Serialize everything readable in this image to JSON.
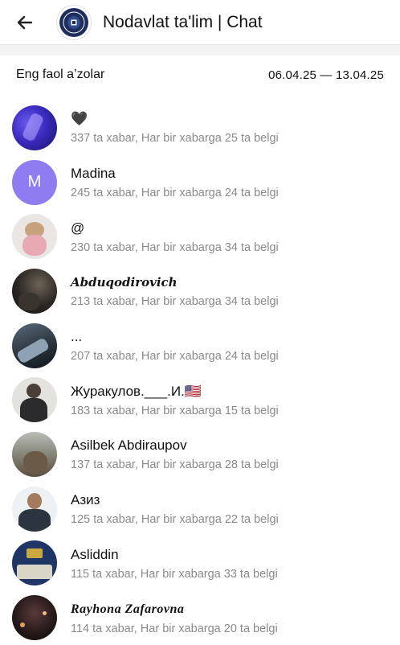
{
  "header": {
    "title": "Nodavlat ta'lim | Chat",
    "back_icon": "arrow-left-icon",
    "logo_icon": "group-logo-icon"
  },
  "section": {
    "title": "Eng faol a’zolar",
    "range": "06.04.25 — 13.04.25"
  },
  "members": [
    {
      "name": "🖤",
      "sub": "337 ta xabar, Har bir xabarga 25 ta belgi"
    },
    {
      "name": "Madina",
      "sub": "245 ta xabar, Har bir xabarga 24 ta belgi",
      "initial": "M"
    },
    {
      "name": "@",
      "sub": "230 ta xabar, Har bir xabarga 34 ta belgi"
    },
    {
      "name": "Abduqodirovich",
      "sub": "213 ta xabar, Har bir xabarga 34 ta belgi"
    },
    {
      "name": "...",
      "sub": "207 ta xabar, Har bir xabarga 24 ta belgi"
    },
    {
      "name": "Журакулов.___.И.🇺🇸",
      "sub": "183 ta xabar, Har bir xabarga 15 ta belgi"
    },
    {
      "name": "Asilbek Abdiraupov",
      "sub": "137 ta xabar, Har bir xabarga 28 ta belgi"
    },
    {
      "name": "Азиз",
      "sub": "125 ta xabar, Har bir xabarga 22 ta belgi"
    },
    {
      "name": "Asliddin",
      "sub": "115 ta xabar, Har bir xabarga 33 ta belgi"
    },
    {
      "name": "Rayhona Zafarovna",
      "sub": "114 ta xabar, Har bir xabarga 20 ta belgi"
    }
  ],
  "colors": {
    "madina_avatar": "#8e7cf0",
    "subtext": "#8a8a8a"
  }
}
